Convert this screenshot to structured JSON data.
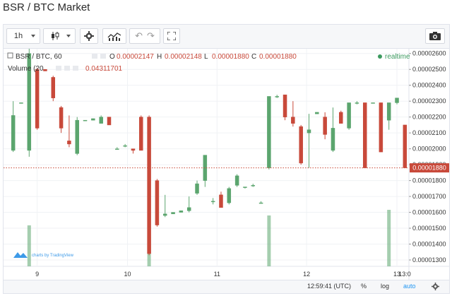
{
  "page": {
    "title": "BSR / BTC Market"
  },
  "toolbar": {
    "interval_label": "1h",
    "icons": [
      "chevron-down-icon",
      "candles-icon",
      "gear-icon",
      "indicators-icon",
      "undo-icon",
      "redo-icon",
      "fullscreen-icon",
      "camera-icon"
    ]
  },
  "legend": {
    "symbol": "BSR / BTC, 60",
    "o_label": "O",
    "o_value": "0.00002147",
    "h_label": "H",
    "h_value": "0.00002148",
    "l_label": "L",
    "l_value": "0.00001880",
    "c_label": "C",
    "c_value": "0.00001880",
    "volume_label": "Volume (20",
    "volume_value": "0.04311701",
    "realtime_label": "realtime"
  },
  "watermark": {
    "text": "charts by TradingView"
  },
  "price_axis": {
    "ticks": [
      "0.00002600",
      "0.00002500",
      "0.00002400",
      "0.00002300",
      "0.00002200",
      "0.00002100",
      "0.00002000",
      "0.00001900",
      "0.00001800",
      "0.00001700",
      "0.00001600",
      "0.00001500",
      "0.00001400",
      "0.00001300"
    ],
    "last_price": "0.00001880"
  },
  "time_axis": {
    "ticks": [
      "9",
      "10",
      "11",
      "12",
      "13",
      "13:0"
    ]
  },
  "bottom_bar": {
    "time": "12:59:41 (UTC)",
    "percent": "%",
    "log": "log",
    "auto": "auto"
  },
  "colors": {
    "up": "#5ba56e",
    "down": "#c8493a",
    "accent": "#2196f3",
    "last_price": "#c8493a"
  },
  "chart_data": {
    "type": "candlestick",
    "title": "BSR / BTC, 60",
    "ylim": [
      1.26e-05,
      2.63e-05
    ],
    "xlabel": "",
    "ylabel": "",
    "candles": [
      {
        "o": 1.99e-05,
        "h": 2.3e-05,
        "l": 1.98e-05,
        "c": 2.21e-05
      },
      {
        "o": 2.29e-05,
        "h": 2.29e-05,
        "l": 2.29e-05,
        "c": 2.29e-05
      },
      {
        "o": 1.99e-05,
        "h": 2.63e-05,
        "l": 1.95e-05,
        "c": 2.6e-05
      },
      {
        "o": 2.5e-05,
        "h": 2.51e-05,
        "l": 2.12e-05,
        "c": 2.13e-05
      },
      {
        "o": 2.5e-05,
        "h": 2.5e-05,
        "l": 2.5e-05,
        "c": 2.49e-05
      },
      {
        "o": 2.45e-05,
        "h": 2.46e-05,
        "l": 2.3e-05,
        "c": 2.32e-05
      },
      {
        "o": 2.26e-05,
        "h": 2.27e-05,
        "l": 2.1e-05,
        "c": 2.13e-05
      },
      {
        "o": 2.05e-05,
        "h": 2.21e-05,
        "l": 2.01e-05,
        "c": 2.03e-05
      },
      {
        "o": 1.97e-05,
        "h": 2.2e-05,
        "l": 1.96e-05,
        "c": 2.18e-05
      },
      {
        "o": 2.18e-05,
        "h": 2.18e-05,
        "l": 2.18e-05,
        "c": 2.18e-05
      },
      {
        "o": 2.18e-05,
        "h": 2.19e-05,
        "l": 2.18e-05,
        "c": 2.19e-05
      },
      {
        "o": 2.16e-05,
        "h": 2.21e-05,
        "l": 2.16e-05,
        "c": 2.2e-05
      },
      {
        "o": 2.2e-05,
        "h": 2.2e-05,
        "l": 2.15e-05,
        "c": 2.15e-05
      },
      {
        "o": 2e-05,
        "h": 2.01e-05,
        "l": 2e-05,
        "c": 2e-05
      },
      {
        "o": 2.02e-05,
        "h": 2.03e-05,
        "l": 2.01e-05,
        "c": 2.02e-05
      },
      {
        "o": 2e-05,
        "h": 2e-05,
        "l": 1.97e-05,
        "c": 1.99e-05
      },
      {
        "o": 2.2e-05,
        "h": 2.21e-05,
        "l": 1.99e-05,
        "c": 1.99e-05
      },
      {
        "o": 2.2e-05,
        "h": 2.21e-05,
        "l": 1.33e-05,
        "c": 1.34e-05
      },
      {
        "o": 1.8e-05,
        "h": 1.81e-05,
        "l": 1.51e-05,
        "c": 1.52e-05
      },
      {
        "o": 1.58e-05,
        "h": 1.71e-05,
        "l": 1.57e-05,
        "c": 1.59e-05
      },
      {
        "o": 1.59e-05,
        "h": 1.6e-05,
        "l": 1.59e-05,
        "c": 1.6e-05
      },
      {
        "o": 1.6e-05,
        "h": 1.61e-05,
        "l": 1.6e-05,
        "c": 1.61e-05
      },
      {
        "o": 1.61e-05,
        "h": 1.7e-05,
        "l": 1.6e-05,
        "c": 1.63e-05
      },
      {
        "o": 1.72e-05,
        "h": 1.8e-05,
        "l": 1.71e-05,
        "c": 1.78e-05
      },
      {
        "o": 1.8e-05,
        "h": 1.96e-05,
        "l": 1.76e-05,
        "c": 1.96e-05
      },
      {
        "o": 1.67e-05,
        "h": 1.69e-05,
        "l": 1.65e-05,
        "c": 1.67e-05
      },
      {
        "o": 1.71e-05,
        "h": 1.73e-05,
        "l": 1.63e-05,
        "c": 1.63e-05
      },
      {
        "o": 1.66e-05,
        "h": 1.76e-05,
        "l": 1.65e-05,
        "c": 1.75e-05
      },
      {
        "o": 1.77e-05,
        "h": 1.84e-05,
        "l": 1.76e-05,
        "c": 1.83e-05
      },
      {
        "o": 1.76e-05,
        "h": 1.76e-05,
        "l": 1.75e-05,
        "c": 1.76e-05
      },
      {
        "o": 1.77e-05,
        "h": 1.78e-05,
        "l": 1.76e-05,
        "c": 1.77e-05
      },
      {
        "o": 1.66e-05,
        "h": 1.67e-05,
        "l": 1.66e-05,
        "c": 1.66e-05
      },
      {
        "o": 1.88e-05,
        "h": 2.33e-05,
        "l": 1.87e-05,
        "c": 2.33e-05
      },
      {
        "o": 2.33e-05,
        "h": 2.34e-05,
        "l": 2.32e-05,
        "c": 2.33e-05
      },
      {
        "o": 2.34e-05,
        "h": 2.34e-05,
        "l": 2.18e-05,
        "c": 2.2e-05
      },
      {
        "o": 2.2e-05,
        "h": 2.3e-05,
        "l": 2.14e-05,
        "c": 2.16e-05
      },
      {
        "o": 2.14e-05,
        "h": 2.15e-05,
        "l": 1.9e-05,
        "c": 1.91e-05
      },
      {
        "o": 2.1e-05,
        "h": 2.22e-05,
        "l": 1.88e-05,
        "c": 2.12e-05
      },
      {
        "o": 2.22e-05,
        "h": 2.23e-05,
        "l": 2.22e-05,
        "c": 2.23e-05
      },
      {
        "o": 2.2e-05,
        "h": 2.23e-05,
        "l": 2.06e-05,
        "c": 2.09e-05
      },
      {
        "o": 1.99e-05,
        "h": 2.26e-05,
        "l": 1.98e-05,
        "c": 2.13e-05
      },
      {
        "o": 2.23e-05,
        "h": 2.24e-05,
        "l": 2.16e-05,
        "c": 2.16e-05
      },
      {
        "o": 2.13e-05,
        "h": 2.29e-05,
        "l": 2.12e-05,
        "c": 2.29e-05
      },
      {
        "o": 2.29e-05,
        "h": 2.3e-05,
        "l": 2.28e-05,
        "c": 2.29e-05
      },
      {
        "o": 2.29e-05,
        "h": 2.29e-05,
        "l": 1.88e-05,
        "c": 1.88e-05
      },
      {
        "o": 2.29e-05,
        "h": 2.29e-05,
        "l": 2.29e-05,
        "c": 2.29e-05
      },
      {
        "o": 2.29e-05,
        "h": 2.29e-05,
        "l": 1.98e-05,
        "c": 1.98e-05
      },
      {
        "o": 2.18e-05,
        "h": 2.29e-05,
        "l": 2.12e-05,
        "c": 2.29e-05
      },
      {
        "o": 2.29e-05,
        "h": 2.32e-05,
        "l": 2.28e-05,
        "c": 2.32e-05
      },
      {
        "o": 2.15e-05,
        "h": 2.15e-05,
        "l": 1.88e-05,
        "c": 1.88e-05
      }
    ],
    "volume": [
      0,
      0,
      58,
      0,
      0,
      0,
      0,
      0,
      0,
      0,
      0,
      0,
      0,
      0,
      0,
      0,
      0,
      42,
      0,
      0,
      0,
      0,
      0,
      0,
      0,
      0,
      0,
      0,
      0,
      0,
      0,
      0,
      72,
      0,
      0,
      0,
      0,
      0,
      0,
      0,
      0,
      0,
      0,
      0,
      0,
      0,
      0,
      80,
      0,
      0
    ]
  }
}
